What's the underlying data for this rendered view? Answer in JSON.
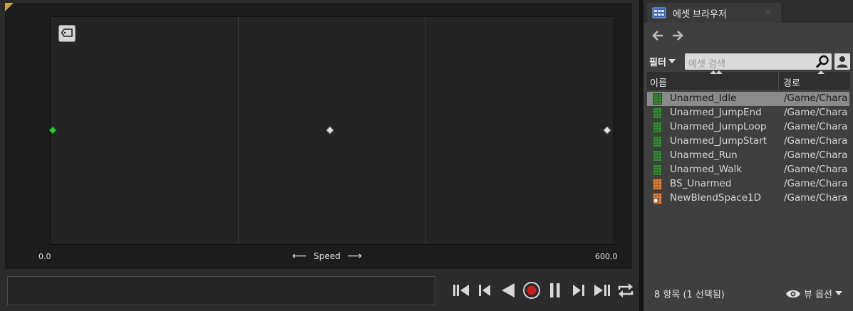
{
  "editor": {
    "axis": {
      "name": "Speed",
      "min_label": "0.0",
      "max_label": "600.0",
      "left_arrow": "⟵",
      "right_arrow": "⟶"
    },
    "samples": [
      {
        "value": 0,
        "state": "selected",
        "color": "#2fd12f"
      },
      {
        "value": 300,
        "state": "normal",
        "color": "#e6e6e6"
      },
      {
        "value": 600,
        "state": "normal",
        "color": "#e6e6e6"
      }
    ],
    "axis_range": [
      0,
      600
    ],
    "timeline_value": "",
    "transport": [
      "skip-to-start-icon",
      "step-back-icon",
      "play-reverse-icon",
      "record-icon",
      "pause-icon",
      "step-forward-icon",
      "skip-to-end-icon",
      "loop-icon"
    ]
  },
  "browser": {
    "tab_title": "에셋 브라우저",
    "filter_label": "필터",
    "search_placeholder": "에셋 검색",
    "columns": {
      "name": "이름",
      "path": "경로"
    },
    "assets": [
      {
        "name": "Unarmed_Idle",
        "path": "/Game/Chara",
        "type": "animation",
        "selected": true
      },
      {
        "name": "Unarmed_JumpEnd",
        "path": "/Game/Chara",
        "type": "animation",
        "selected": false
      },
      {
        "name": "Unarmed_JumpLoop",
        "path": "/Game/Chara",
        "type": "animation",
        "selected": false
      },
      {
        "name": "Unarmed_JumpStart",
        "path": "/Game/Chara",
        "type": "animation",
        "selected": false
      },
      {
        "name": "Unarmed_Run",
        "path": "/Game/Chara",
        "type": "animation",
        "selected": false
      },
      {
        "name": "Unarmed_Walk",
        "path": "/Game/Chara",
        "type": "animation",
        "selected": false
      },
      {
        "name": "BS_Unarmed",
        "path": "/Game/Chara",
        "type": "blendspace",
        "selected": false
      },
      {
        "name": "NewBlendSpace1D",
        "path": "/Game/Chara",
        "type": "blendspace-new",
        "selected": false
      }
    ],
    "status": "8 항목 (1 선택됨)",
    "view_options": "뷰 옵션"
  },
  "colors": {
    "accent_selected_sample": "#2fd12f",
    "animation_icon": "#3e8f3e",
    "blendspace_icon": "#e08a4a"
  }
}
